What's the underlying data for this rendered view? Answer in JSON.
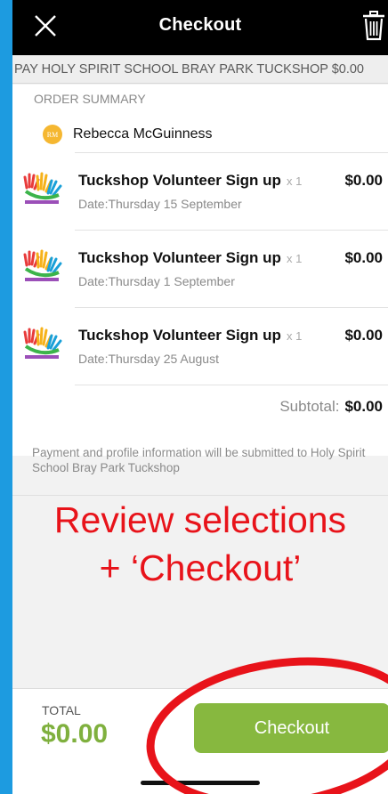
{
  "header": {
    "title": "Checkout",
    "close_icon": "close-icon",
    "delete_icon": "trash-icon"
  },
  "pay_banner": "PAY HOLY SPIRIT SCHOOL BRAY PARK TUCKSHOP $0.00",
  "order_summary": {
    "label": "ORDER SUMMARY",
    "customer": {
      "initials": "RM",
      "name": "Rebecca McGuinness"
    },
    "items": [
      {
        "name": "Tuckshop Volunteer Sign up",
        "date": "Date:Thursday 15 September",
        "qty": "x 1",
        "price": "$0.00"
      },
      {
        "name": "Tuckshop Volunteer Sign up",
        "date": "Date:Thursday 1 September",
        "qty": "x 1",
        "price": "$0.00"
      },
      {
        "name": "Tuckshop Volunteer Sign up",
        "date": "Date:Thursday 25 August",
        "qty": "x 1",
        "price": "$0.00"
      }
    ],
    "subtotal_label": "Subtotal:",
    "subtotal_value": "$0.00"
  },
  "notice": "Payment and profile information will be submitted to Holy Spirit School Bray Park Tuckshop",
  "annotation": {
    "line1": "Review selections",
    "line2": "+ ‘Checkout’",
    "color": "#e8131a"
  },
  "footer": {
    "total_label": "TOTAL",
    "total_value": "$0.00",
    "checkout_label": "Checkout"
  },
  "colors": {
    "background": "#1d9be0",
    "accent_green": "#87b83f",
    "total_green": "#7fb03e",
    "avatar": "#f5b731"
  }
}
